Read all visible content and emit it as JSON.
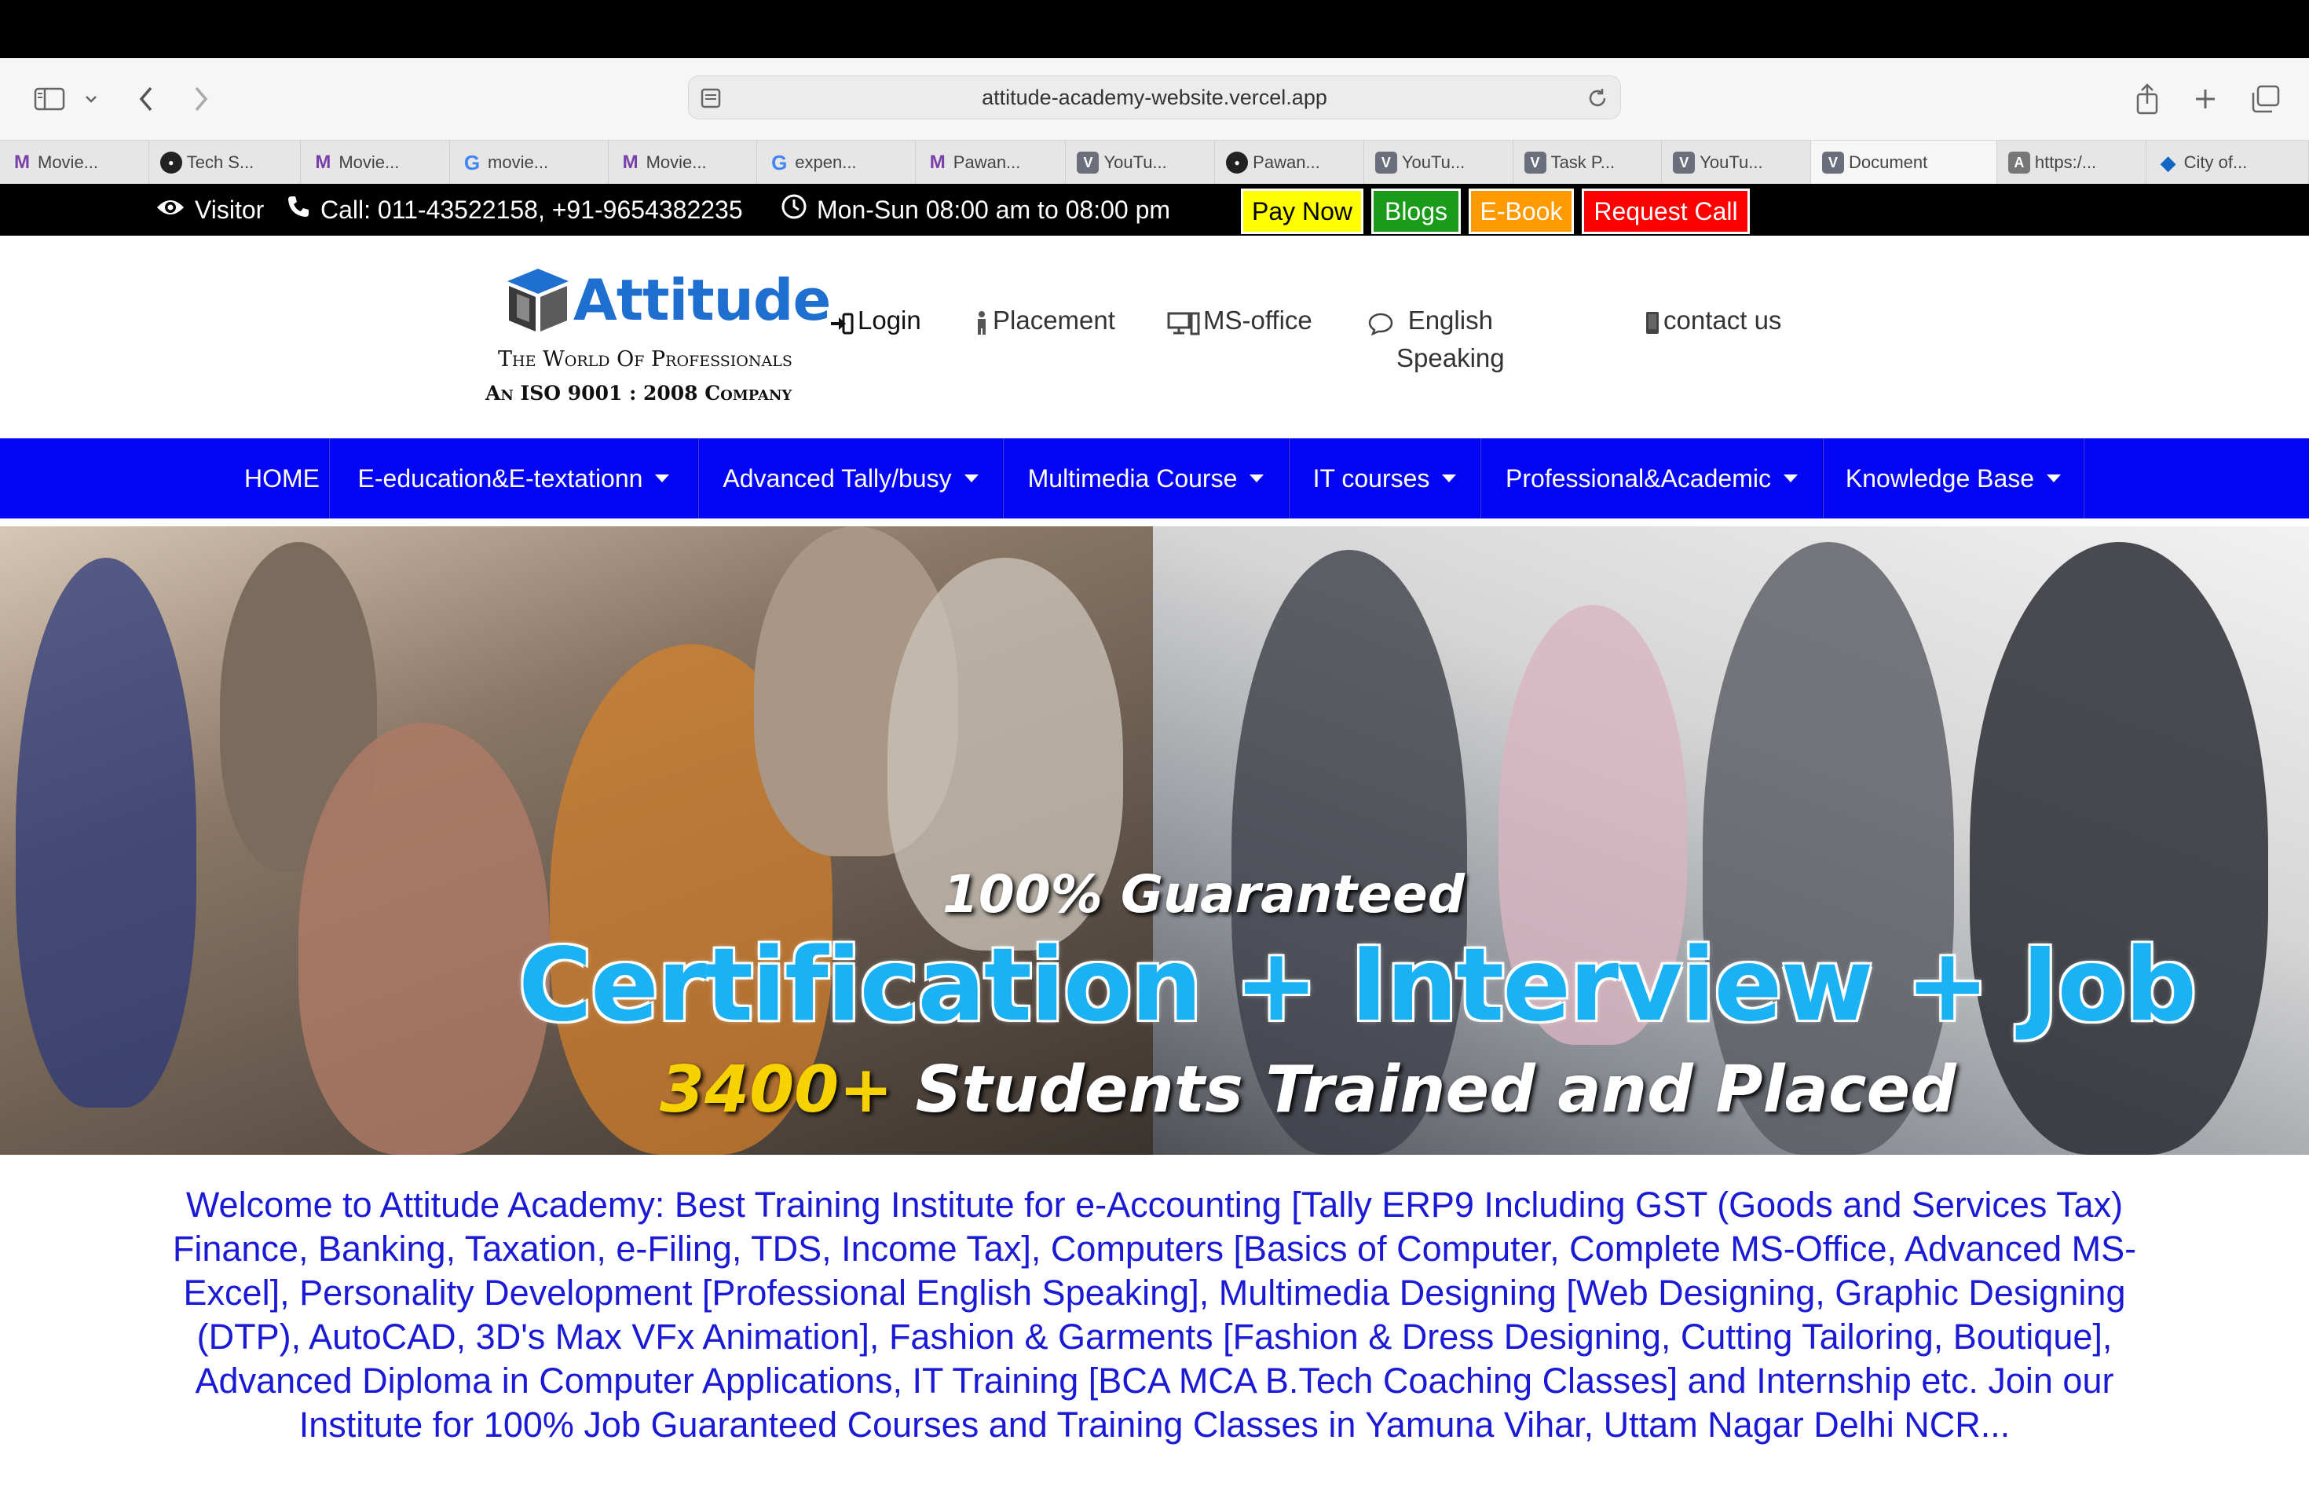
{
  "browser": {
    "url": "attitude-academy-website.vercel.app",
    "tabs": [
      {
        "favicon": "M",
        "type": "m",
        "label": "Movie..."
      },
      {
        "favicon": "●",
        "type": "gh",
        "label": "Tech S..."
      },
      {
        "favicon": "M",
        "type": "m",
        "label": "Movie..."
      },
      {
        "favicon": "G",
        "type": "g",
        "label": "movie..."
      },
      {
        "favicon": "M",
        "type": "m",
        "label": "Movie..."
      },
      {
        "favicon": "G",
        "type": "g",
        "label": "expen..."
      },
      {
        "favicon": "M",
        "type": "m",
        "label": "Pawan..."
      },
      {
        "favicon": "V",
        "type": "v",
        "label": "YouTu..."
      },
      {
        "favicon": "●",
        "type": "gh",
        "label": "Pawan..."
      },
      {
        "favicon": "V",
        "type": "v",
        "label": "YouTu..."
      },
      {
        "favicon": "V",
        "type": "v",
        "label": "Task P..."
      },
      {
        "favicon": "V",
        "type": "v",
        "label": "YouTu..."
      },
      {
        "favicon": "V",
        "type": "v",
        "label": "Document",
        "active": true
      },
      {
        "favicon": "A",
        "type": "a",
        "label": "https:/..."
      },
      {
        "favicon": "◆",
        "type": "blue",
        "label": "City of..."
      }
    ]
  },
  "infobar": {
    "visitor": "Visitor",
    "call": "Call: 011-43522158, +91-9654382235",
    "hours": "Mon-Sun 08:00 am to 08:00 pm",
    "pay_now": "Pay Now",
    "blogs": "Blogs",
    "ebook": "E-Book",
    "request_call": "Request Call",
    "colors": {
      "pay_now": "#ffff00",
      "blogs": "#1a9c1a",
      "ebook": "#ff9a00",
      "request_call": "#ff0000"
    }
  },
  "header": {
    "brand": "Attitude",
    "tagline": "The World Of Professionals",
    "iso": "An ISO 9001 : 2008 Company",
    "links": {
      "login": "Login",
      "placement": "Placement",
      "ms_office": "MS-office",
      "english_1": "English",
      "english_2": "Speaking",
      "contact": "contact us"
    }
  },
  "nav": {
    "home": "HOME",
    "items": [
      "E-education&E-textationn",
      "Advanced Tally/busy",
      "Multimedia Course",
      "IT courses",
      "Professional&Academic",
      "Knowledge Base"
    ]
  },
  "hero": {
    "line1": "100% Guaranteed",
    "line2": "Certification + Interview + Job",
    "line3_num": "3400+",
    "line3_text": " Students Trained and Placed"
  },
  "welcome": "Welcome to Attitude Academy: Best Training Institute for e-Accounting [Tally ERP9 Including GST (Goods and Services Tax) Finance, Banking, Taxation, e-Filing, TDS, Income Tax], Computers [Basics of Computer, Complete MS-Office, Advanced MS-Excel], Personality Development [Professional English Speaking], Multimedia Designing [Web Designing, Graphic Designing (DTP), AutoCAD, 3D's Max VFx Animation], Fashion & Garments [Fashion & Dress Designing, Cutting Tailoring, Boutique], Advanced Diploma in Computer Applications, IT Training [BCA MCA B.Tech Coaching Classes] and Internship etc. Join our Institute for 100% Job Guaranteed Courses and Training Classes in Yamuna Vihar, Uttam Nagar Delhi NCR..."
}
